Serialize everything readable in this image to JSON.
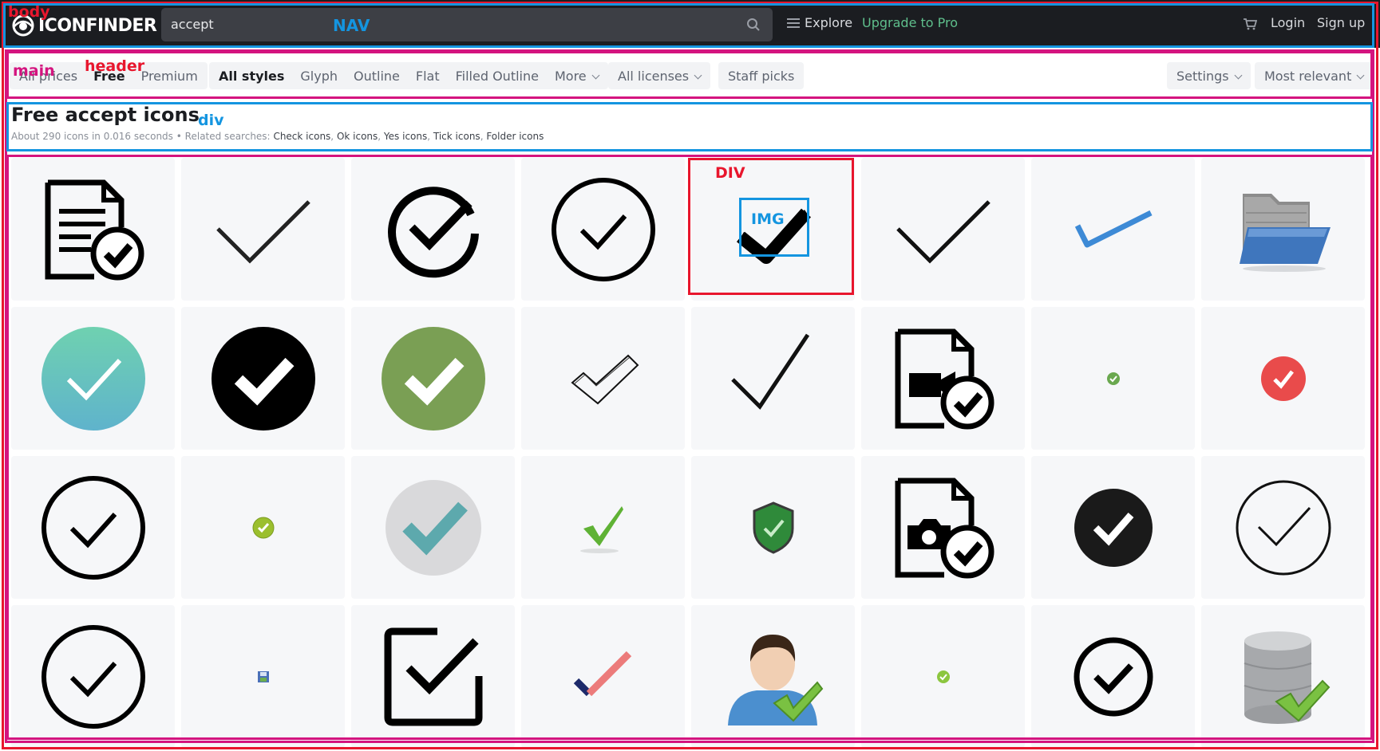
{
  "nav": {
    "logo_text": "ICONFINDER",
    "search_value": "accept",
    "explore_label": "Explore",
    "upgrade_label": "Upgrade to Pro",
    "login_label": "Login",
    "signup_label": "Sign up"
  },
  "filters": {
    "prices": [
      "All prices",
      "Free",
      "Premium"
    ],
    "active_price": "Free",
    "styles": [
      "All styles",
      "Glyph",
      "Outline",
      "Flat",
      "Filled Outline",
      "More"
    ],
    "active_style": "All styles",
    "licenses_label": "All licenses",
    "staff_picks_label": "Staff picks",
    "settings_label": "Settings",
    "sort_label": "Most relevant"
  },
  "results": {
    "title": "Free accept icons",
    "summary": "About 290 icons in 0.016 seconds",
    "separator": "•",
    "related_label": "Related searches:",
    "related": [
      "Check icons",
      "Ok icons",
      "Yes icons",
      "Tick icons",
      "Folder icons"
    ]
  },
  "annotations": {
    "body": "body",
    "nav": "NAV",
    "main": "main",
    "header": "header",
    "div": "div",
    "grid_div": "DIV",
    "img": "IMG"
  },
  "colors": {
    "nav_bg": "#1b1d21",
    "accent_green": "#5fbf8c",
    "annotation_red": "#e8162d",
    "annotation_blue": "#1495e0",
    "annotation_magenta": "#d4147f"
  },
  "icons": [
    "document-check-icon",
    "checkmark-thin-icon",
    "circle-check-open-icon",
    "circle-check-outline-icon",
    "checkmark-bold-icon",
    "checkmark-thin-icon",
    "checkmark-blue-icon",
    "folder-open-icon",
    "teal-circle-check-icon",
    "black-circle-check-icon",
    "green-circle-check-icon",
    "sketch-check-icon",
    "checkmark-thin-icon",
    "video-file-check-icon",
    "tiny-green-check-icon",
    "red-circle-check-icon",
    "circle-check-outline-icon",
    "small-yellow-check-icon",
    "grey-circle-teal-check-icon",
    "green-check-icon",
    "shield-check-icon",
    "camera-file-check-icon",
    "black-circle-check-icon",
    "circle-check-thin-icon",
    "circle-check-outline-icon",
    "floppy-icon",
    "square-check-icon",
    "red-blue-check-icon",
    "user-check-icon",
    "tiny-green-check-icon",
    "circle-check-outline-icon",
    "database-check-icon"
  ]
}
